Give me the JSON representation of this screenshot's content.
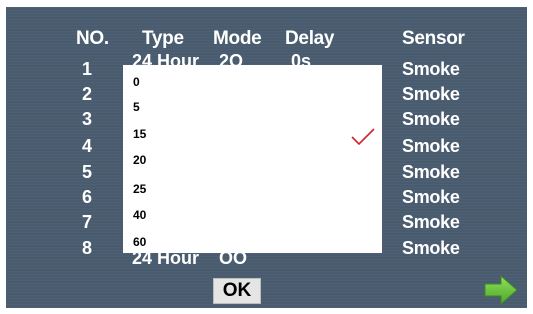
{
  "header": {
    "no": "NO.",
    "type": "Type",
    "mode": "Mode",
    "delay": "Delay",
    "sensor": "Sensor"
  },
  "rows": [
    {
      "no": "1",
      "sensor": "Smoke"
    },
    {
      "no": "2",
      "sensor": "Smoke"
    },
    {
      "no": "3",
      "sensor": "Smoke"
    },
    {
      "no": "4",
      "sensor": "Smoke"
    },
    {
      "no": "5",
      "sensor": "Smoke"
    },
    {
      "no": "6",
      "sensor": "Smoke"
    },
    {
      "no": "7",
      "sensor": "Smoke"
    },
    {
      "no": "8",
      "sensor": "Smoke"
    }
  ],
  "row1_partial": {
    "type": "24 Hour",
    "mode": "2O",
    "delay": "0s"
  },
  "row8_partial": {
    "type": "24 Hour",
    "mode": "OO"
  },
  "delay_dropdown": {
    "options": [
      "0",
      "5",
      "15",
      "20",
      "25",
      "40",
      "60"
    ],
    "selected": "15"
  },
  "buttons": {
    "ok_label": "OK"
  },
  "icons": {
    "check": "checkmark-icon",
    "next": "right-arrow-icon"
  },
  "colors": {
    "panel_bg": "#495b6e",
    "check": "#d6202a",
    "arrow": "#6cc43a"
  }
}
